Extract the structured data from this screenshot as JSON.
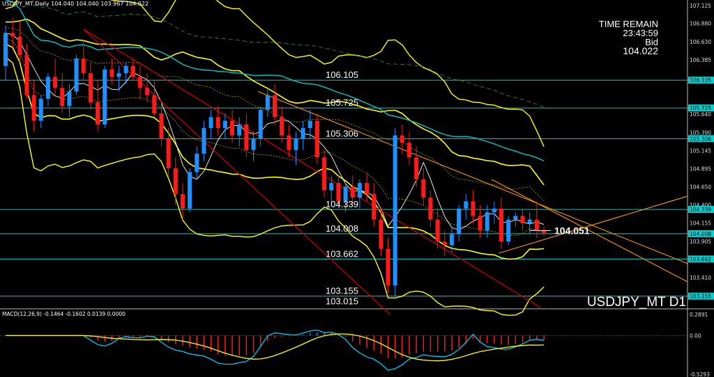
{
  "header": {
    "symbol_line": "USDJPY_MT,Daily 104.040 104.040 103.967 104.022",
    "macd_line": "MACD(12,26,9) -0.1464 -0.1602 0.0139 0.0000"
  },
  "info": {
    "time_remain_label": "TIME REMAIN",
    "time_remain": "23:43:59",
    "bid_label": "Bid",
    "bid": "104.022"
  },
  "symbol_caption": "USDJPY_MT D1",
  "colors": {
    "background": "#000000",
    "bull": "#1e90ff",
    "bear": "#ff1a1a",
    "level_line": "#00cfcf",
    "bands": "#ffff00",
    "ma_cyan": "#00c8c8",
    "trend_red": "#cc0000",
    "trend_orange": "#ff9900",
    "macd_signal": "#ffff00",
    "macd_main": "#00c8ff"
  },
  "chart_data": {
    "type": "candlestick",
    "title": "USDJPY_MT,Daily",
    "yaxis": {
      "ticks": [
        107.125,
        106.88,
        106.63,
        106.385,
        106.105,
        105.725,
        105.64,
        105.39,
        105.306,
        105.145,
        104.895,
        104.65,
        104.4,
        104.339,
        104.155,
        104.008,
        103.905,
        103.662,
        103.41,
        103.155
      ],
      "range": [
        103.0,
        107.2
      ],
      "highlighted_ticks": [
        106.105,
        105.725,
        105.306,
        104.339,
        104.008,
        103.662,
        103.155
      ]
    },
    "levels": [
      {
        "value": 106.105,
        "label": "106.105"
      },
      {
        "value": 105.725,
        "label": "105.725"
      },
      {
        "value": 105.306,
        "label": "105.306"
      },
      {
        "value": 104.339,
        "label": "104.339"
      },
      {
        "value": 104.008,
        "label": "104.008"
      },
      {
        "value": 103.662,
        "label": "103.662"
      },
      {
        "value": 103.155,
        "label": "103.155"
      },
      {
        "value": 103.015,
        "label": "103.015"
      }
    ],
    "current_price": {
      "value": 104.051,
      "label": "104.051"
    },
    "candles": [
      [
        106.3,
        106.85,
        106.1,
        106.75
      ],
      [
        106.75,
        106.95,
        106.55,
        106.7
      ],
      [
        106.7,
        106.9,
        106.35,
        106.45
      ],
      [
        106.45,
        106.6,
        105.85,
        105.9
      ],
      [
        105.9,
        106.1,
        105.4,
        105.55
      ],
      [
        105.55,
        105.9,
        105.45,
        105.85
      ],
      [
        105.85,
        106.2,
        105.75,
        106.15
      ],
      [
        106.15,
        106.4,
        105.9,
        106.0
      ],
      [
        106.0,
        106.2,
        105.65,
        105.75
      ],
      [
        105.75,
        106.05,
        105.6,
        105.95
      ],
      [
        105.95,
        106.45,
        105.9,
        106.4
      ],
      [
        106.4,
        106.65,
        106.1,
        106.2
      ],
      [
        106.2,
        106.35,
        105.7,
        105.8
      ],
      [
        105.8,
        106.1,
        105.4,
        105.5
      ],
      [
        105.5,
        106.3,
        105.45,
        106.25
      ],
      [
        106.25,
        106.4,
        106.05,
        106.15
      ],
      [
        106.15,
        106.3,
        105.95,
        106.2
      ],
      [
        106.2,
        106.35,
        106.05,
        106.3
      ],
      [
        106.3,
        106.4,
        106.1,
        106.15
      ],
      [
        106.15,
        106.3,
        105.85,
        106.0
      ],
      [
        106.0,
        106.2,
        105.8,
        105.9
      ],
      [
        105.9,
        106.1,
        105.6,
        105.65
      ],
      [
        105.65,
        105.8,
        105.2,
        105.3
      ],
      [
        105.3,
        105.45,
        104.8,
        104.9
      ],
      [
        104.9,
        105.05,
        104.4,
        104.55
      ],
      [
        104.55,
        104.7,
        104.2,
        104.35
      ],
      [
        104.35,
        104.9,
        104.3,
        104.85
      ],
      [
        104.85,
        105.2,
        104.75,
        105.1
      ],
      [
        105.1,
        105.55,
        105.0,
        105.45
      ],
      [
        105.45,
        105.7,
        105.3,
        105.6
      ],
      [
        105.6,
        105.75,
        105.35,
        105.45
      ],
      [
        105.45,
        105.65,
        105.3,
        105.55
      ],
      [
        105.55,
        105.7,
        105.25,
        105.35
      ],
      [
        105.35,
        105.6,
        105.2,
        105.5
      ],
      [
        105.5,
        105.65,
        105.05,
        105.15
      ],
      [
        105.15,
        105.4,
        105.0,
        105.3
      ],
      [
        105.3,
        105.75,
        105.2,
        105.7
      ],
      [
        105.7,
        106.0,
        105.6,
        105.9
      ],
      [
        105.9,
        106.05,
        105.5,
        105.6
      ],
      [
        105.6,
        105.75,
        105.25,
        105.35
      ],
      [
        105.35,
        105.5,
        105.05,
        105.15
      ],
      [
        105.15,
        105.4,
        104.95,
        105.3
      ],
      [
        105.3,
        105.55,
        105.15,
        105.45
      ],
      [
        105.45,
        105.7,
        105.3,
        105.55
      ],
      [
        105.55,
        105.65,
        104.95,
        105.05
      ],
      [
        105.05,
        105.15,
        104.5,
        104.6
      ],
      [
        104.6,
        104.8,
        104.4,
        104.7
      ],
      [
        104.7,
        104.8,
        104.35,
        104.45
      ],
      [
        104.45,
        104.7,
        104.3,
        104.65
      ],
      [
        104.65,
        104.8,
        104.4,
        104.5
      ],
      [
        104.5,
        104.75,
        104.35,
        104.7
      ],
      [
        104.7,
        104.85,
        104.45,
        104.55
      ],
      [
        104.55,
        104.7,
        104.1,
        104.2
      ],
      [
        104.2,
        104.35,
        103.7,
        103.8
      ],
      [
        103.8,
        103.95,
        103.2,
        103.3
      ],
      [
        103.3,
        105.45,
        103.15,
        105.35
      ],
      [
        105.35,
        105.5,
        105.1,
        105.25
      ],
      [
        105.25,
        105.4,
        104.95,
        105.05
      ],
      [
        105.05,
        105.2,
        104.65,
        104.75
      ],
      [
        104.75,
        104.9,
        104.4,
        104.5
      ],
      [
        104.5,
        104.6,
        104.1,
        104.2
      ],
      [
        104.2,
        104.35,
        103.8,
        103.9
      ],
      [
        103.9,
        104.05,
        103.7,
        103.85
      ],
      [
        103.85,
        104.1,
        103.75,
        104.0
      ],
      [
        104.0,
        104.4,
        103.9,
        104.35
      ],
      [
        104.35,
        104.55,
        104.2,
        104.45
      ],
      [
        104.45,
        104.6,
        104.15,
        104.25
      ],
      [
        104.25,
        104.4,
        103.95,
        104.05
      ],
      [
        104.05,
        104.4,
        103.95,
        104.3
      ],
      [
        104.3,
        104.45,
        104.15,
        104.35
      ],
      [
        104.35,
        104.5,
        103.8,
        103.9
      ],
      [
        103.9,
        104.25,
        103.85,
        104.2
      ],
      [
        104.2,
        104.3,
        104.1,
        104.25
      ],
      [
        104.25,
        104.35,
        104.05,
        104.15
      ],
      [
        104.15,
        104.3,
        104.0,
        104.2
      ],
      [
        104.2,
        104.45,
        103.95,
        104.05
      ],
      [
        104.05,
        104.1,
        103.97,
        104.02
      ]
    ],
    "macd": {
      "label": "MACD(12,26,9)",
      "main": -0.1464,
      "signal": -0.1602,
      "histogram": 0.0139,
      "yaxis_ticks": [
        0.2891,
        0.0,
        -0.5293
      ]
    }
  }
}
